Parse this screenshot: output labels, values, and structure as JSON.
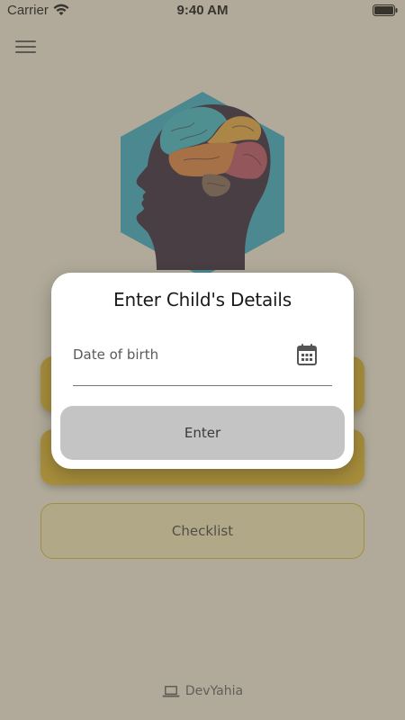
{
  "status_bar": {
    "carrier": "Carrier",
    "time": "9:40 AM"
  },
  "menu": {
    "items": [
      {
        "label": ""
      },
      {
        "label": ""
      },
      {
        "label": "Checklist"
      }
    ]
  },
  "footer": {
    "text": "DevYahia",
    "icon": "laptop-icon"
  },
  "dialog": {
    "title": "Enter Child's Details",
    "date_placeholder": "Date of birth",
    "enter_label": "Enter",
    "calendar_icon": "calendar-icon"
  },
  "colors": {
    "background": "#f4edd8",
    "gold": "#e0b31c",
    "hexagon": "#2aa8c4",
    "button_gray": "#c4c4c4"
  }
}
